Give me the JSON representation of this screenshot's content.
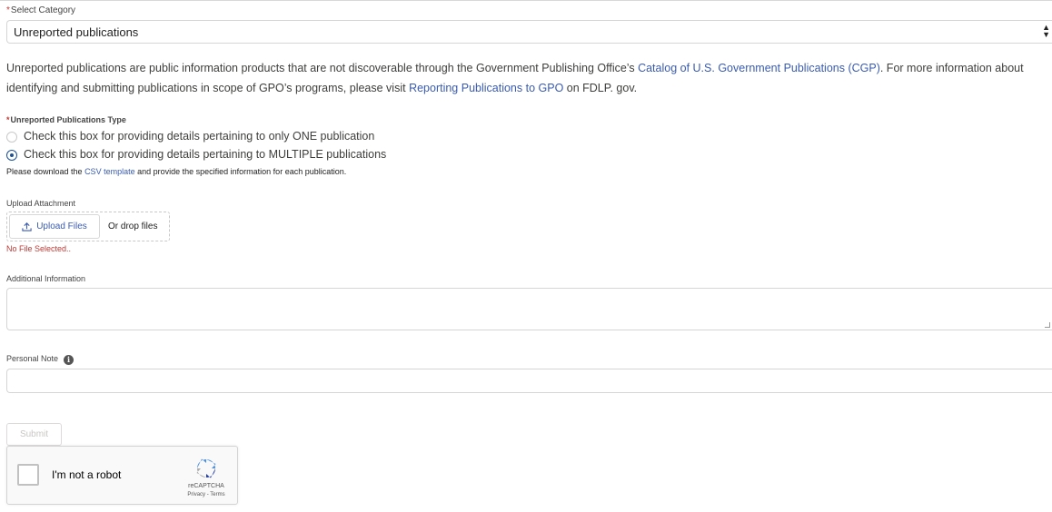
{
  "category": {
    "label": "Select Category",
    "required_mark": "*",
    "selected": "Unreported publications"
  },
  "description": {
    "part1": "Unreported publications are public information products that are not discoverable through the Government Publishing Office’s ",
    "link1": "Catalog of U.S. Government Publications (CGP)",
    "part2": ". For more information about identifying and submitting publications in scope of GPO’s programs, please visit ",
    "link2": "Reporting Publications to GPO",
    "part3": " on FDLP. gov."
  },
  "pub_type": {
    "label": "Unreported Publications Type",
    "required_mark": "*",
    "options": [
      {
        "label": "Check this box for providing details pertaining to only ONE publication",
        "checked": false
      },
      {
        "label": "Check this box for providing details pertaining to MULTIPLE publications",
        "checked": true
      }
    ],
    "note_before": "Please download the ",
    "note_link": "CSV template",
    "note_after": " and provide the specified information for each publication."
  },
  "upload": {
    "label": "Upload Attachment",
    "button_label": "Upload Files",
    "drop_text": "Or drop files",
    "error": "No File Selected..",
    "icon": "upload-icon"
  },
  "additional": {
    "label": "Additional Information",
    "value": ""
  },
  "personal_note": {
    "label": "Personal Note",
    "info_icon": "info-icon",
    "value": ""
  },
  "submit": {
    "label": "Submit"
  },
  "recaptcha": {
    "label": "I'm not a robot",
    "brand": "reCAPTCHA",
    "terms": "Privacy - Terms"
  },
  "colors": {
    "link": "#3a5bb0",
    "required": "#c23934",
    "radio_checked": "#1b5297",
    "submit_disabled_text": "#c9c7c5"
  }
}
